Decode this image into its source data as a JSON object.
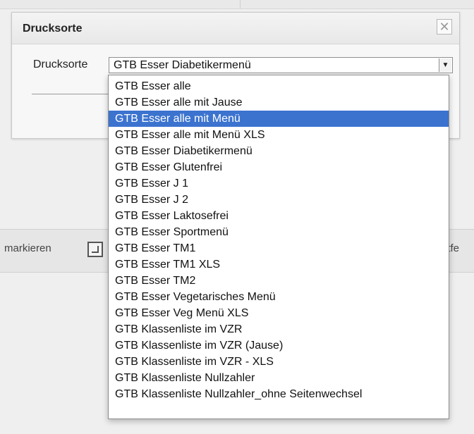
{
  "background": {
    "left_label": "markieren",
    "right_label": "ntfe"
  },
  "dialog": {
    "title": "Drucksorte",
    "close_icon": "✕",
    "field_label": "Drucksorte",
    "select_value": "GTB Esser Diabetikermenü",
    "select_arrow_icon": "▼"
  },
  "dropdown": {
    "highlight_color": "#3b73cf",
    "highlighted_index": 2,
    "options": [
      "GTB Esser alle",
      "GTB Esser alle mit Jause",
      "GTB Esser alle mit Menü",
      "GTB Esser alle mit Menü XLS",
      "GTB Esser Diabetikermenü",
      "GTB Esser Glutenfrei",
      "GTB Esser J 1",
      "GTB Esser J 2",
      "GTB Esser Laktosefrei",
      "GTB Esser Sportmenü",
      "GTB Esser TM1",
      "GTB Esser TM1 XLS",
      "GTB Esser TM2",
      "GTB Esser Vegetarisches Menü",
      "GTB Esser Veg Menü XLS",
      "GTB Klassenliste im VZR",
      "GTB Klassenliste im VZR (Jause)",
      "GTB Klassenliste im VZR - XLS",
      "GTB Klassenliste Nullzahler",
      "GTB Klassenliste Nullzahler_ohne Seitenwechsel"
    ]
  }
}
